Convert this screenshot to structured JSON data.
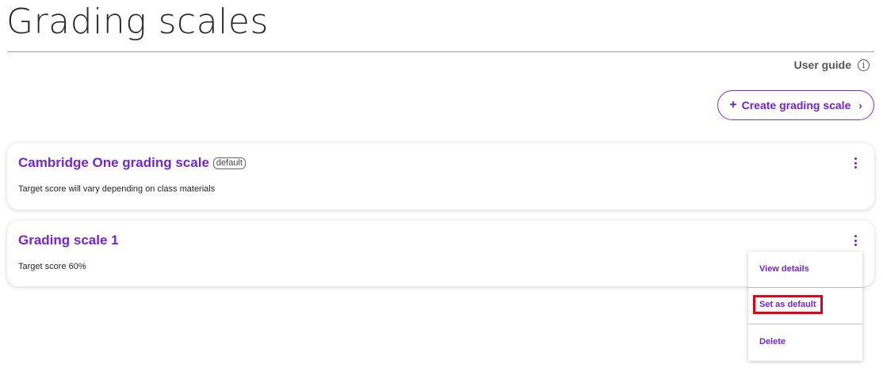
{
  "page": {
    "title": "Grading scales"
  },
  "header": {
    "user_guide_label": "User guide",
    "info_glyph": "i",
    "create_button_label": "Create grading scale",
    "create_button_plus": "+",
    "create_button_chevron": "›"
  },
  "scales": [
    {
      "name": "Cambridge One grading scale",
      "badge": "default",
      "description": "Target score will vary depending on class materials"
    },
    {
      "name": "Grading scale 1",
      "description": "Target score 60%"
    }
  ],
  "menu": {
    "view_details": "View details",
    "set_as_default": "Set as default",
    "delete": "Delete"
  },
  "colors": {
    "accent": "#7325d4",
    "highlight": "#e0001a"
  },
  "icons": {
    "info": "info-icon",
    "plus": "plus-icon",
    "chevron": "chevron-right-icon",
    "kebab": "kebab-menu-icon"
  }
}
